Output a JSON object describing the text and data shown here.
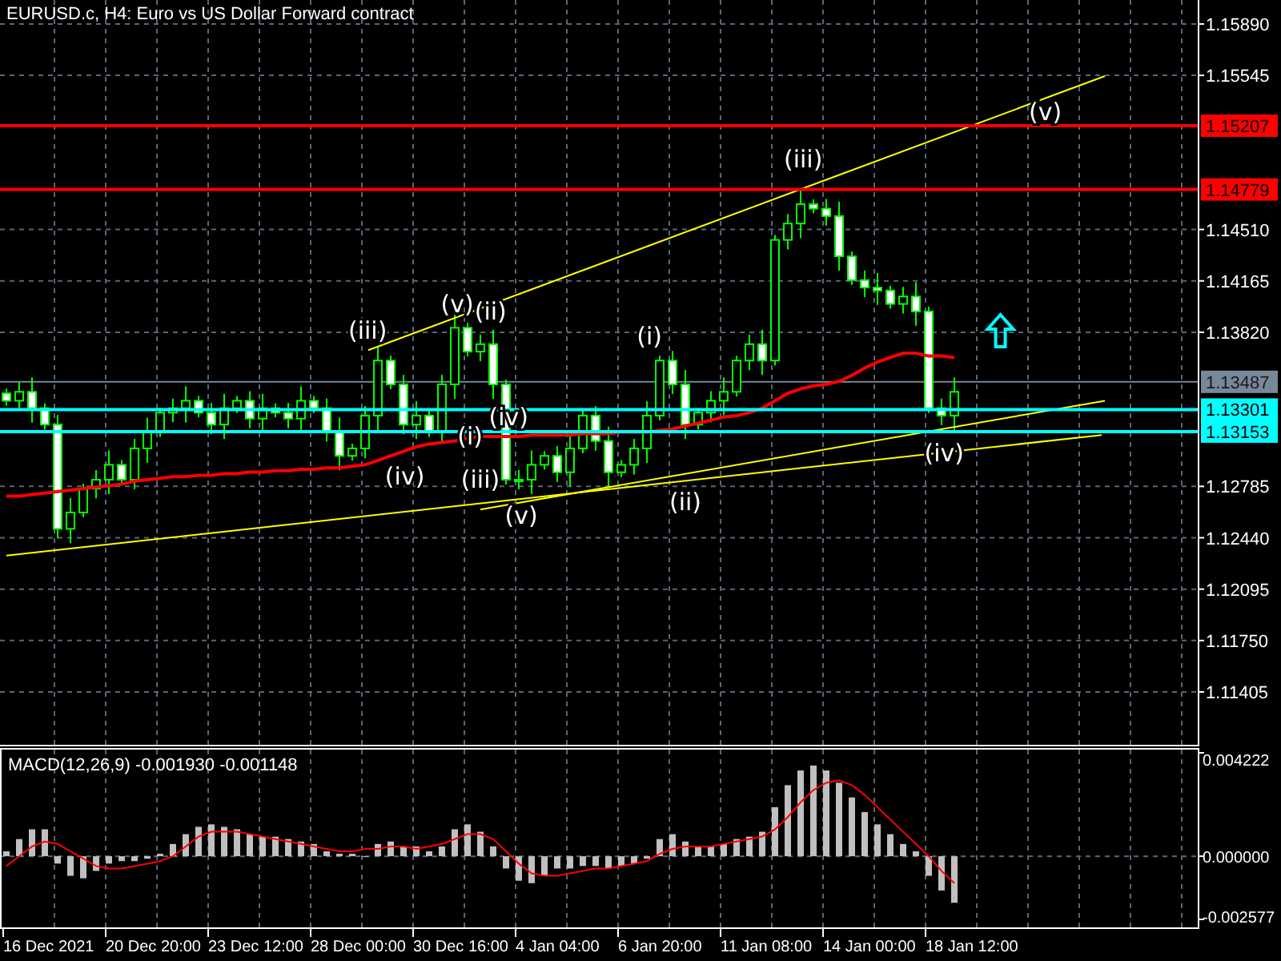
{
  "window": {
    "title": "EURUSD.c, H4:  Euro vs US Dollar Forward contract"
  },
  "price_chart": {
    "axis_labels": [
      "1.15890",
      "1.15545",
      "1.14510",
      "1.14165",
      "1.13820",
      "1.12785",
      "1.12440",
      "1.12095",
      "1.11750",
      "1.11405"
    ],
    "levels": [
      {
        "label": "1.15207",
        "color": "#ff0000"
      },
      {
        "label": "1.14779",
        "color": "#ff0000"
      },
      {
        "label": "1.13301",
        "color": "#00ffff"
      },
      {
        "label": "1.13153",
        "color": "#00ffff"
      }
    ],
    "current_price": "1.13487",
    "wave_labels": [
      "(iii)",
      "(v)",
      "(ii)",
      "(iv)",
      "(i)",
      "(iii)",
      "(v)",
      "(iv)",
      "(i)",
      "(ii)",
      "(iii)",
      "(iv)",
      "(v)"
    ]
  },
  "macd_chart": {
    "title": "MACD(12,26,9) -0.001930 -0.001148",
    "axis_labels": [
      "0.004222",
      "0.000000",
      "-0.002577"
    ]
  },
  "time_axis": {
    "labels": [
      "16 Dec 2021",
      "20 Dec 20:00",
      "23 Dec 12:00",
      "28 Dec 00:00",
      "30 Dec 16:00",
      "4 Jan 04:00",
      "6 Jan 20:00",
      "11 Jan 08:00",
      "14 Jan 00:00",
      "18 Jan 12:00"
    ]
  }
}
